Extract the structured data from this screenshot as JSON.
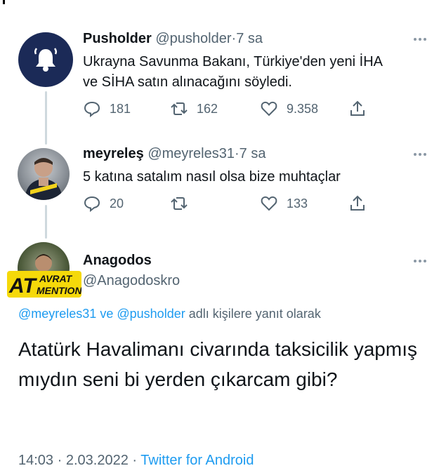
{
  "tweets": [
    {
      "name": "Pusholder",
      "handle": "@pusholder",
      "dot": "·",
      "time": "7 sa",
      "text_line1": "Ukrayna Savunma Bakanı, Türkiye'den yeni İHA",
      "text_line2": "ve SİHA satın alınacağını söyledi.",
      "replies": "181",
      "retweets": "162",
      "likes": "9.358",
      "avatar_icon": "bell-icon"
    },
    {
      "name": "meyreleş",
      "handle": "@meyreles31",
      "dot": "·",
      "time": "7 sa",
      "text_line1": "5 katına satalım nasıl olsa bize muhtaçlar",
      "replies": "20",
      "retweets": "",
      "likes": "133"
    }
  ],
  "main_tweet": {
    "name": "Anagodos",
    "handle": "@Anagodoskro",
    "reply_to_user1": "@meyreles31",
    "reply_joiner": "ve",
    "reply_to_user2": "@pusholder",
    "reply_suffix": "adlı kişilere yanıt olarak",
    "text": "Atatürk Havalimanı civarında taksicilik yapmış mıydın seni bi yerden çıkarcam gibi?",
    "time": "14:03",
    "date": "2.03.2022",
    "sep": "·",
    "source": "Twitter for Android"
  },
  "watermark": {
    "letters": "AT",
    "line1": "AVRAT",
    "line2": "MENTION"
  },
  "colors": {
    "accent": "#1d9bf0",
    "muted": "#536471",
    "thread_line": "#cfd9de",
    "watermark_yellow": "#f5d90a"
  }
}
